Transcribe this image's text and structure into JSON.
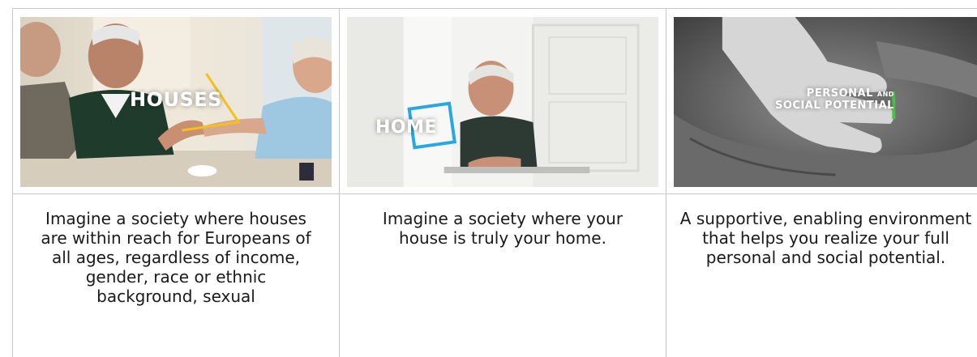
{
  "cards": [
    {
      "image_label": "HOUSES",
      "accent": "#f2c21b",
      "description": "Imagine a society where houses are within reach for Europeans of all ages, regardless of income, gender, race or ethnic background, sexual"
    },
    {
      "image_label": "HOME",
      "accent": "#29a8e0",
      "description": "Imagine a society where your house is truly your home."
    },
    {
      "image_label_line1_main": "PERSONAL",
      "image_label_line1_small": "AND",
      "image_label_line2": "SOCIAL POTENTIAL",
      "accent": "#4cc24a",
      "description": "A supportive, enabling environment that helps you realize your full personal and social potential."
    }
  ]
}
